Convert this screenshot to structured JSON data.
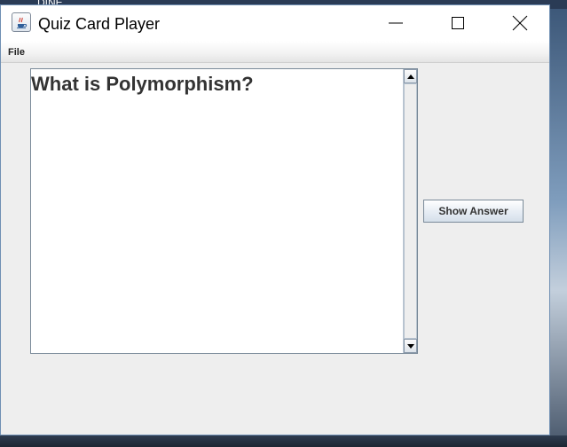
{
  "desktop": {
    "partial_label": "DINE"
  },
  "window": {
    "title": "Quiz Card Player",
    "icon": "java-coffee-cup-icon",
    "controls": {
      "minimize": "minimize-icon",
      "maximize": "maximize-icon",
      "close": "close-icon"
    }
  },
  "menubar": {
    "file_label": "File"
  },
  "card": {
    "question_text": "What is Polymorphism?"
  },
  "actions": {
    "show_answer_label": "Show Answer"
  },
  "colors": {
    "window_bg": "#eeeeee",
    "text": "#333333",
    "border": "#7a8a99"
  }
}
